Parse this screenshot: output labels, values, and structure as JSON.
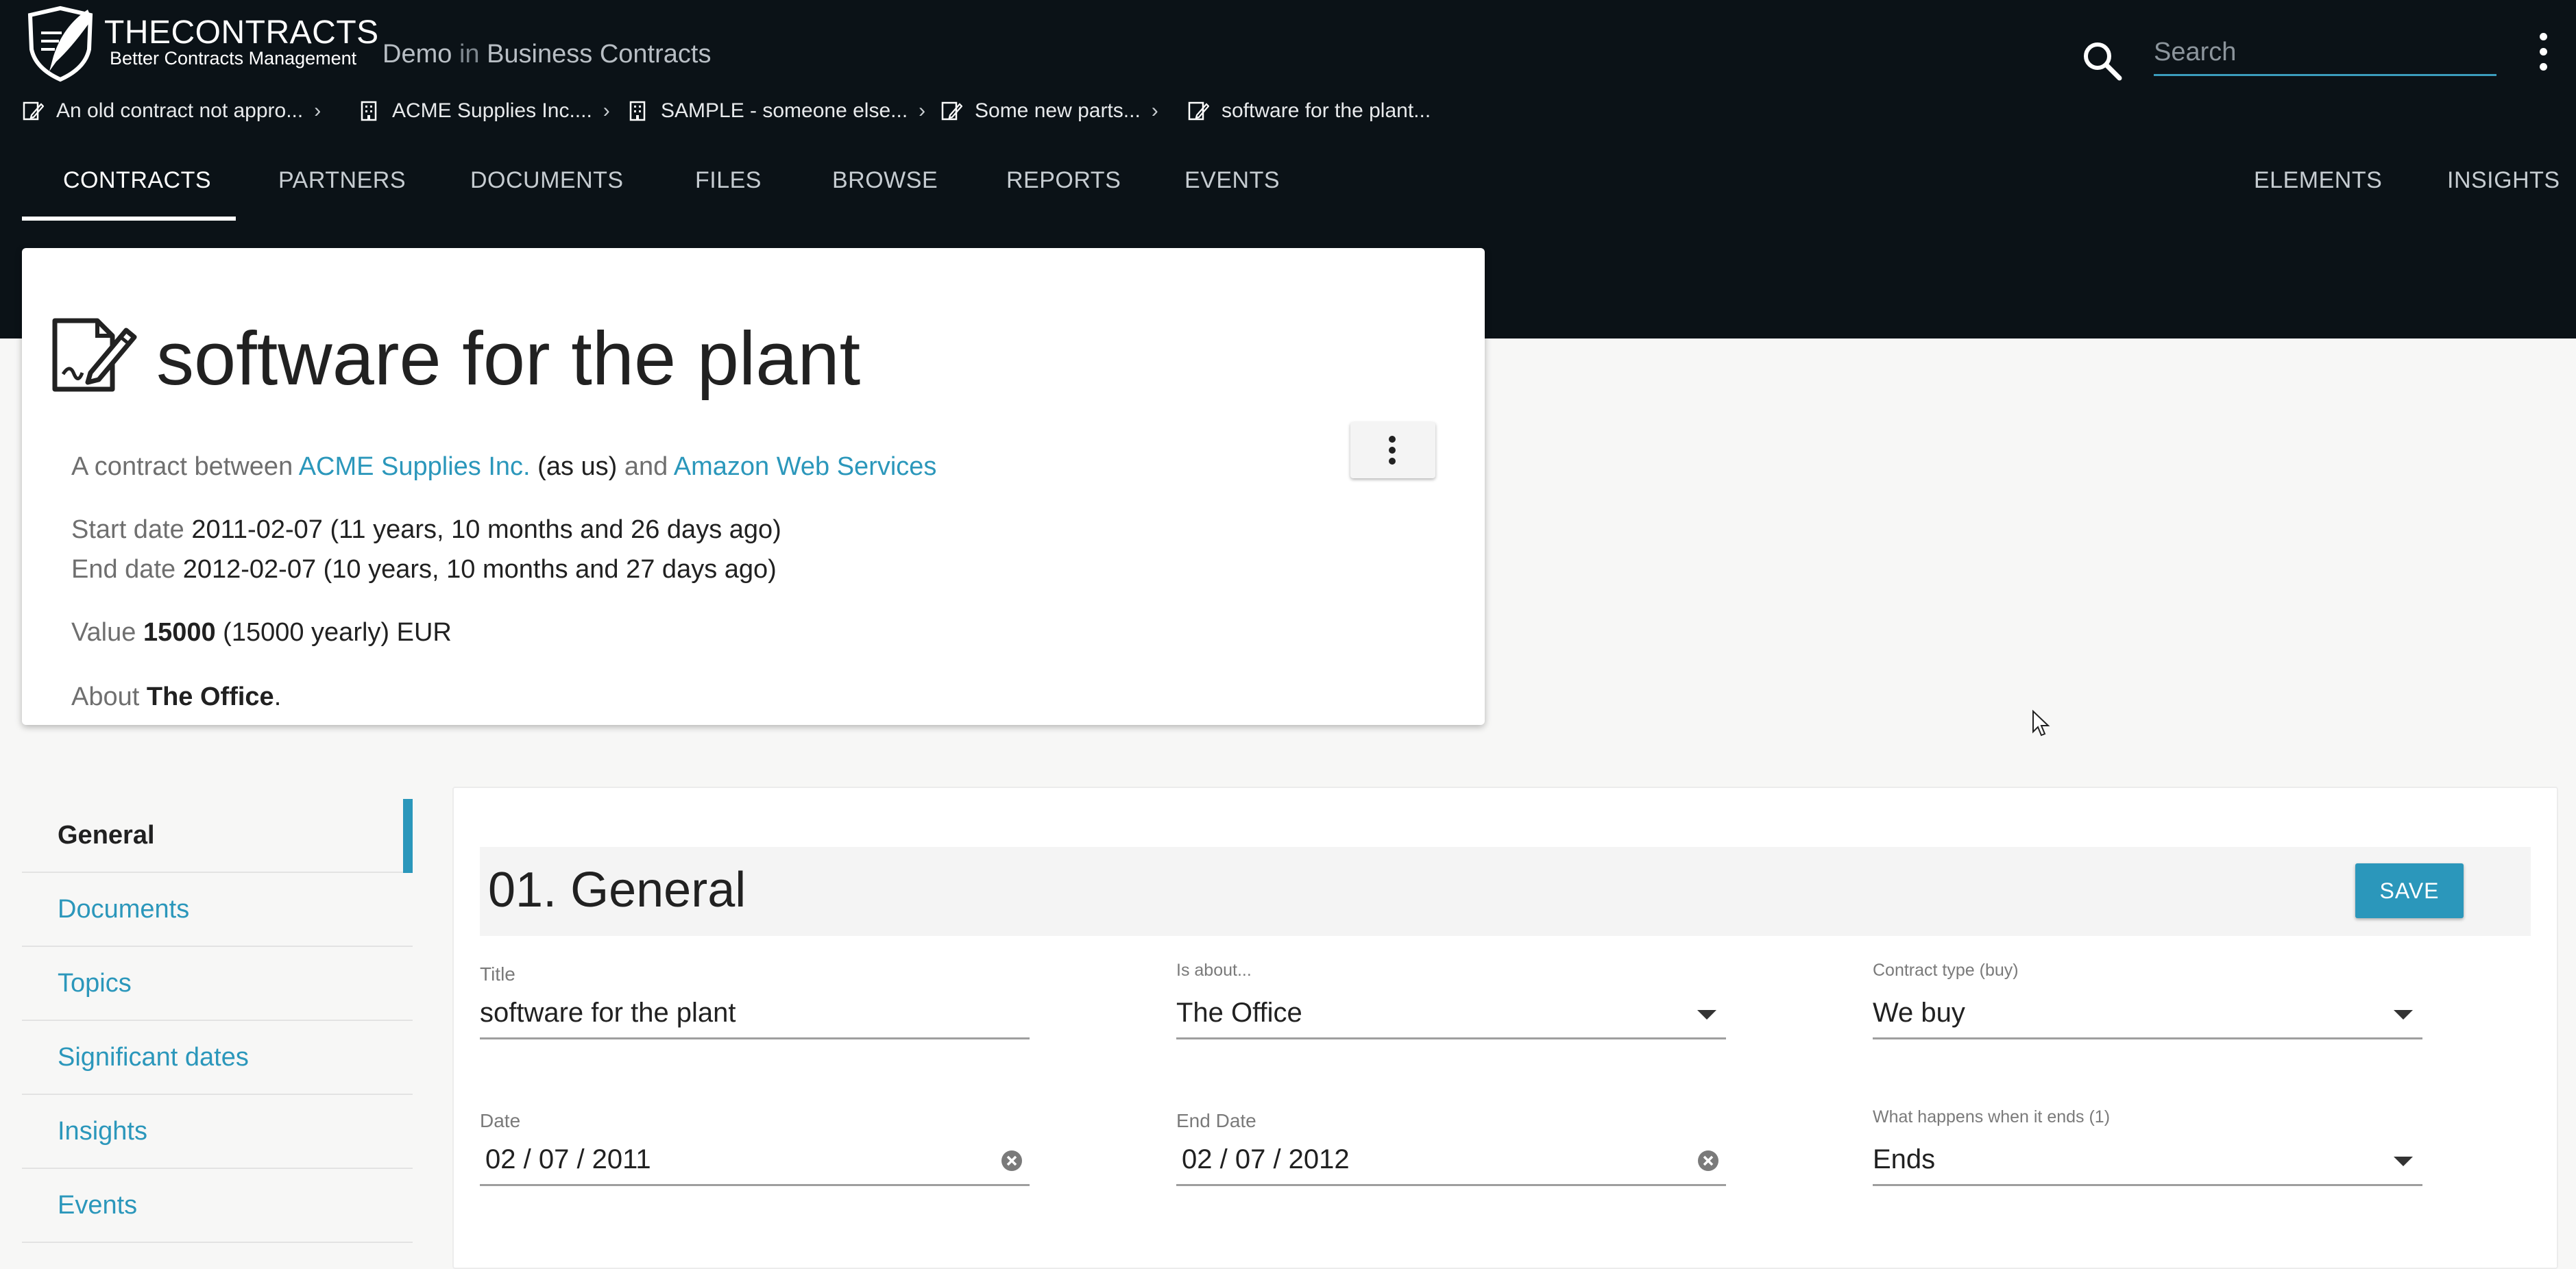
{
  "brand": {
    "name": "THECONTRACTS",
    "tagline": "Better Contracts Management"
  },
  "workspace": {
    "demo": "Demo",
    "in": "in",
    "name": "Business Contracts"
  },
  "search": {
    "placeholder": "Search"
  },
  "breadcrumbs": [
    {
      "label": "An old contract not appro...",
      "icon": "contract-icon"
    },
    {
      "label": "ACME Supplies Inc....",
      "icon": "building-icon"
    },
    {
      "label": "SAMPLE - someone else...",
      "icon": "building-icon"
    },
    {
      "label": "Some new parts...",
      "icon": "contract-icon"
    },
    {
      "label": "software for the plant...",
      "icon": "contract-icon"
    }
  ],
  "tabs": {
    "contracts": "CONTRACTS",
    "partners": "PARTNERS",
    "documents": "DOCUMENTS",
    "files": "FILES",
    "browse": "BROWSE",
    "reports": "REPORTS",
    "events": "EVENTS",
    "elements": "ELEMENTS",
    "insights": "INSIGHTS",
    "active": "CONTRACTS"
  },
  "contract": {
    "title": "software for the plant",
    "between_prefix": "A contract between",
    "party_us": "ACME Supplies Inc.",
    "as_us": "(as us)",
    "and": "and",
    "party_other": "Amazon Web Services",
    "start_label": "Start date",
    "start_value": "2011-02-07 (11 years, 10 months and 26 days ago)",
    "end_label": "End date",
    "end_value": "2012-02-07 (10 years, 10 months and 27 days ago)",
    "value_label": "Value",
    "value_amount": "15000",
    "value_rest": "(15000 yearly) EUR",
    "about_label": "About",
    "about_value": "The Office",
    "about_end": "."
  },
  "sidenav": {
    "items": [
      "General",
      "Documents",
      "Topics",
      "Significant dates",
      "Insights",
      "Events"
    ],
    "active": "General"
  },
  "section": {
    "title": "01. General",
    "save_label": "SAVE",
    "fields": {
      "title": {
        "label": "Title",
        "value": "software for the plant"
      },
      "about": {
        "label": "Is about...",
        "value": "The Office"
      },
      "type": {
        "label": "Contract type (buy)",
        "value": "We buy"
      },
      "date": {
        "label": "Date",
        "value": "02 / 07 / 2011"
      },
      "end_date": {
        "label": "End Date",
        "value": "02 / 07 / 2012"
      },
      "ends": {
        "label": "What happens when it ends (1)",
        "value": "Ends"
      }
    }
  },
  "colors": {
    "topbar": "#0b1217",
    "accent": "#2b97bb",
    "background": "#f7f7f6"
  }
}
